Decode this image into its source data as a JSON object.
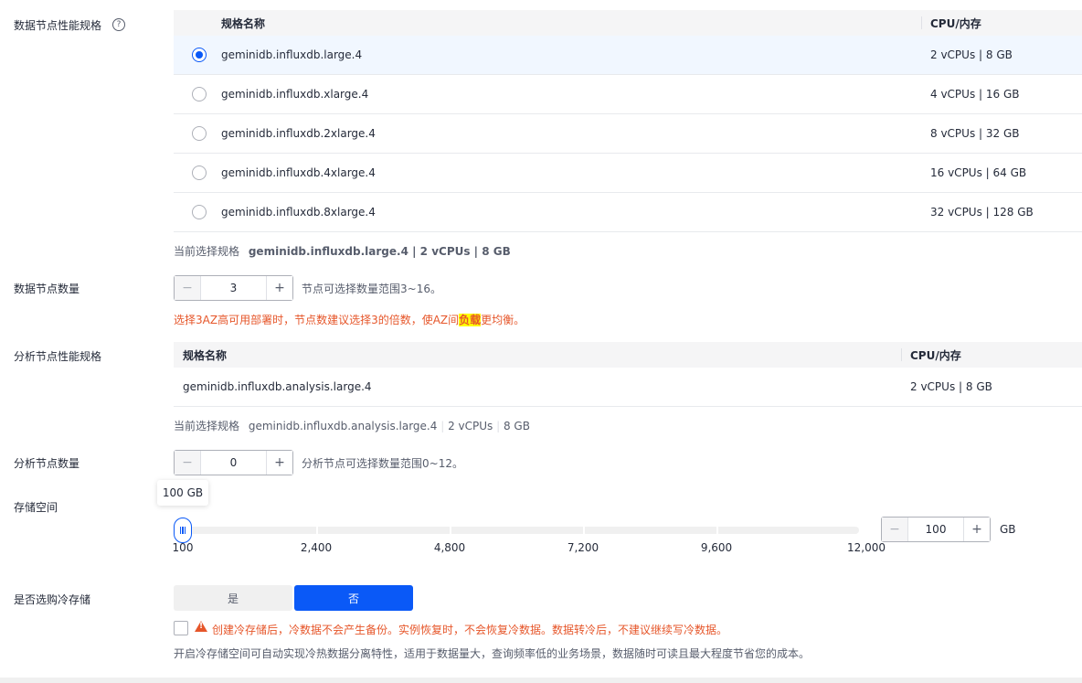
{
  "data_node_spec": {
    "label": "数据节点性能规格",
    "help": "?",
    "col_name": "规格名称",
    "col_cpu": "CPU/内存",
    "rows": [
      {
        "name": "geminidb.influxdb.large.4",
        "cpu": "2 vCPUs | 8 GB",
        "selected": true
      },
      {
        "name": "geminidb.influxdb.xlarge.4",
        "cpu": "4 vCPUs | 16 GB",
        "selected": false
      },
      {
        "name": "geminidb.influxdb.2xlarge.4",
        "cpu": "8 vCPUs | 32 GB",
        "selected": false
      },
      {
        "name": "geminidb.influxdb.4xlarge.4",
        "cpu": "16 vCPUs | 64 GB",
        "selected": false
      },
      {
        "name": "geminidb.influxdb.8xlarge.4",
        "cpu": "32 vCPUs | 128 GB",
        "selected": false
      }
    ],
    "summary_label": "当前选择规格",
    "summary_value": "geminidb.influxdb.large.4 | 2 vCPUs | 8 GB"
  },
  "data_node_count": {
    "label": "数据节点数量",
    "minus": "−",
    "value": "3",
    "plus": "+",
    "hint": "节点可选择数量范围3~16。",
    "warn_before": "选择3AZ高可用部署时，节点数建议选择3的倍数，使AZ间",
    "warn_highlight": "负载",
    "warn_after": "更均衡。"
  },
  "analysis_node_spec": {
    "label": "分析节点性能规格",
    "col_name": "规格名称",
    "col_cpu": "CPU/内存",
    "row_name": "geminidb.influxdb.analysis.large.4",
    "row_cpu": "2 vCPUs | 8 GB",
    "summary_label": "当前选择规格",
    "summary_name": "geminidb.influxdb.analysis.large.4",
    "summary_cpu": "2 vCPUs",
    "summary_mem": "8 GB"
  },
  "analysis_node_count": {
    "label": "分析节点数量",
    "minus": "−",
    "value": "0",
    "plus": "+",
    "hint": "分析节点可选择数量范围0~12。"
  },
  "storage": {
    "label": "存储空间",
    "tooltip": "100 GB",
    "slider_value": 100,
    "slider_min": 100,
    "slider_max": 12000,
    "ticks": [
      "100",
      "2,400",
      "4,800",
      "7,200",
      "9,600",
      "12,000"
    ],
    "minus": "−",
    "value": "100",
    "plus": "+",
    "unit": "GB"
  },
  "cold_storage": {
    "label": "是否选购冷存储",
    "yes": "是",
    "no": "否",
    "warning": "创建冷存储后，冷数据不会产生备份。实例恢复时，不会恢复冷数据。数据转冷后，不建议继续写冷数据。",
    "description": "开启冷存储空间可自动实现冷热数据分离特性，适用于数据量大，查询频率低的业务场景，数据随时可读且最大程度节省您的成本。"
  },
  "colors": {
    "accent": "#0a59f7",
    "warning": "#e6562a",
    "highlight": "#ffff00"
  }
}
